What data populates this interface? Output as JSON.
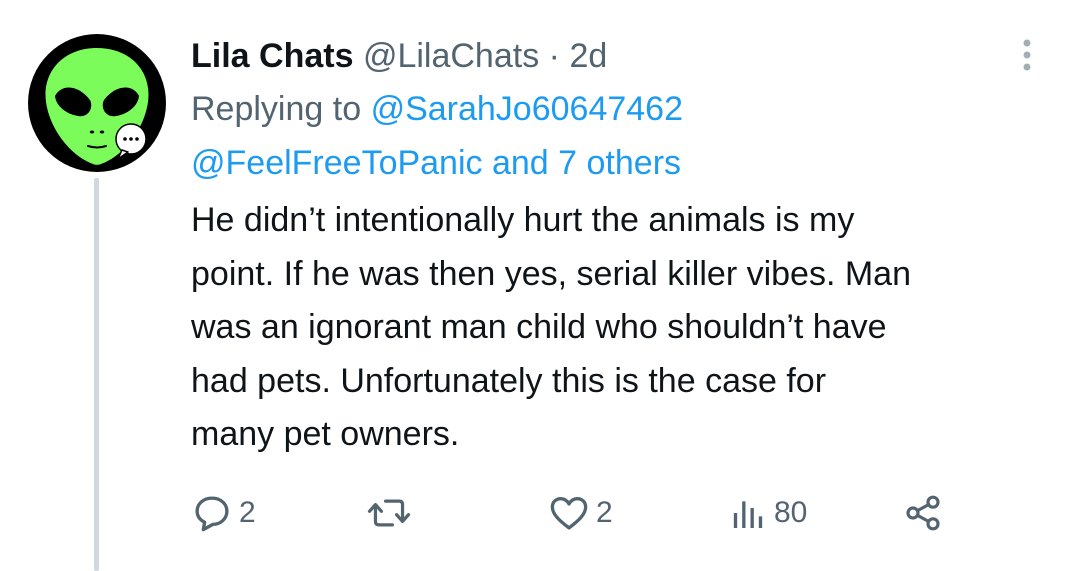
{
  "tweet": {
    "display_name": "Lila Chats",
    "handle": "@LilaChats",
    "separator": "·",
    "time": "2d",
    "replying_prefix": "Replying to",
    "reply_mention_1": "@SarahJo60647462",
    "reply_mention_2": "@FeelFreeToPanic",
    "reply_others": "and 7 others",
    "text": "He didn’t intentionally hurt the animals is my\npoint. If he was then yes, serial killer vibes. Man\nwas an ignorant man child who shouldn’t have\nhad pets. Unfortunately this is the case for\nmany pet owners."
  },
  "actions": {
    "reply_count": "2",
    "retweet_count": "",
    "like_count": "2",
    "views_count": "80"
  },
  "icons": {
    "avatar": "green-alien-face",
    "badge": "speech-bubble-ellipsis",
    "more": "vertical-ellipsis",
    "reply": "speech-bubble",
    "retweet": "retweet-arrows",
    "like": "heart",
    "views": "bar-chart",
    "share": "share-nodes"
  },
  "colors": {
    "text_primary": "#0f1419",
    "text_secondary": "#536471",
    "link": "#1d9bf0",
    "thread_line": "#cfd9de",
    "avatar_bg": "#000000",
    "alien_green": "#7cfc5a"
  }
}
